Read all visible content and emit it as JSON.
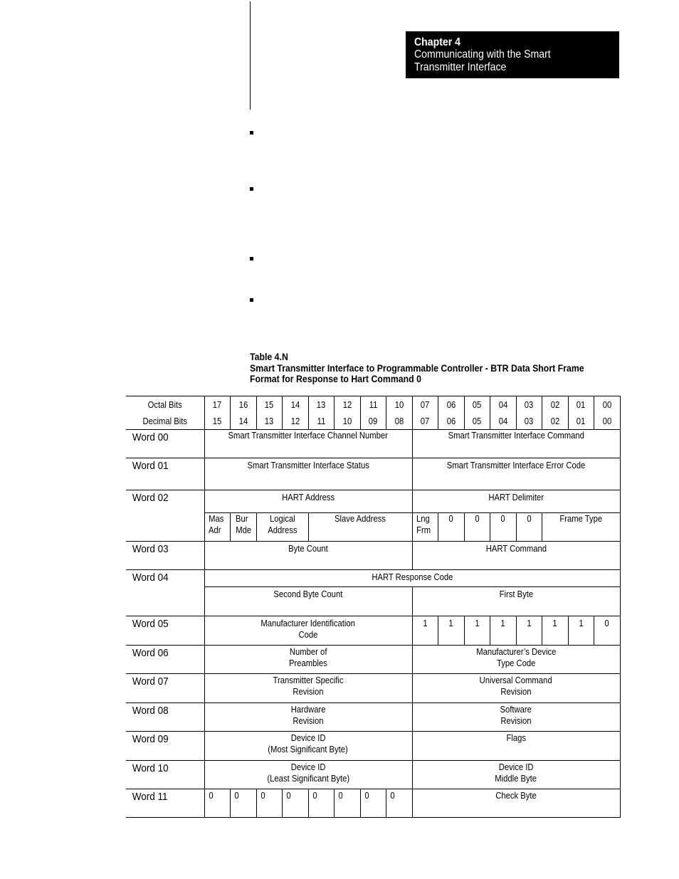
{
  "header": {
    "chapter": "Chapter 4",
    "subtitle_line1": "Communicating with the Smart",
    "subtitle_line2": "Transmitter Interface"
  },
  "table": {
    "number": "Table 4.N",
    "title_line1": "Smart Transmitter Interface to Programmable Controller - BTR Data Short Frame",
    "title_line2": "Format for Response to Hart Command 0",
    "octal_label": "Octal Bits",
    "decimal_label": "Decimal Bits",
    "octal_bits": [
      "17",
      "16",
      "15",
      "14",
      "13",
      "12",
      "11",
      "10",
      "07",
      "06",
      "05",
      "04",
      "03",
      "02",
      "01",
      "00"
    ],
    "decimal_bits": [
      "15",
      "14",
      "13",
      "12",
      "11",
      "10",
      "09",
      "08",
      "07",
      "06",
      "05",
      "04",
      "03",
      "02",
      "01",
      "00"
    ],
    "words": {
      "w00": {
        "label": "Word 00",
        "high": "Smart Transmitter Interface Channel Number",
        "low": "Smart Transmitter Interface Command"
      },
      "w01": {
        "label": "Word 01",
        "high": "Smart Transmitter Interface Status",
        "low": "Smart Transmitter Interface Error Code"
      },
      "w02": {
        "label": "Word 02",
        "high": "HART Address",
        "low": "HART Delimiter",
        "high_sub": {
          "mas_l1": "Mas",
          "mas_l2": "Adr",
          "bur_l1": "Bur",
          "bur_l2": "Mde",
          "log_l1": "Logical",
          "log_l2": "Address",
          "slave": "Slave Address"
        },
        "low_sub": {
          "lng_l1": "Lng",
          "lng_l2": "Frm",
          "bits": [
            "0",
            "0",
            "0",
            "0"
          ],
          "frame": "Frame Type"
        }
      },
      "w03": {
        "label": "Word 03",
        "high": "Byte Count",
        "low": "HART Command"
      },
      "w04": {
        "label": "Word 04",
        "full": "HART Response Code",
        "high": "Second Byte Count",
        "low": "First Byte"
      },
      "w05": {
        "label": "Word 05",
        "high_l1": "Manufacturer Identification",
        "high_l2": "Code",
        "low_bits": [
          "1",
          "1",
          "1",
          "1",
          "1",
          "1",
          "1",
          "0"
        ]
      },
      "w06": {
        "label": "Word 06",
        "high_l1": "Number of",
        "high_l2": "Preambles",
        "low_l1": "Manufacturer’s Device",
        "low_l2": "Type Code"
      },
      "w07": {
        "label": "Word 07",
        "high_l1": "Transmitter Specific",
        "high_l2": "Revision",
        "low_l1": "Universal Command",
        "low_l2": "Revision"
      },
      "w08": {
        "label": "Word 08",
        "high_l1": "Hardware",
        "high_l2": "Revision",
        "low_l1": "Software",
        "low_l2": "Revision"
      },
      "w09": {
        "label": "Word 09",
        "high_l1": "Device ID",
        "high_l2": "(Most Significant Byte)",
        "low": "Flags"
      },
      "w10": {
        "label": "Word 10",
        "high_l1": "Device ID",
        "high_l2": "(Least Significant Byte)",
        "low_l1": "Device ID",
        "low_l2": "Middle Byte"
      },
      "w11": {
        "label": "Word 11",
        "high_bits": [
          "0",
          "0",
          "0",
          "0",
          "0",
          "0",
          "0",
          "0"
        ],
        "low": "Check Byte"
      }
    }
  }
}
